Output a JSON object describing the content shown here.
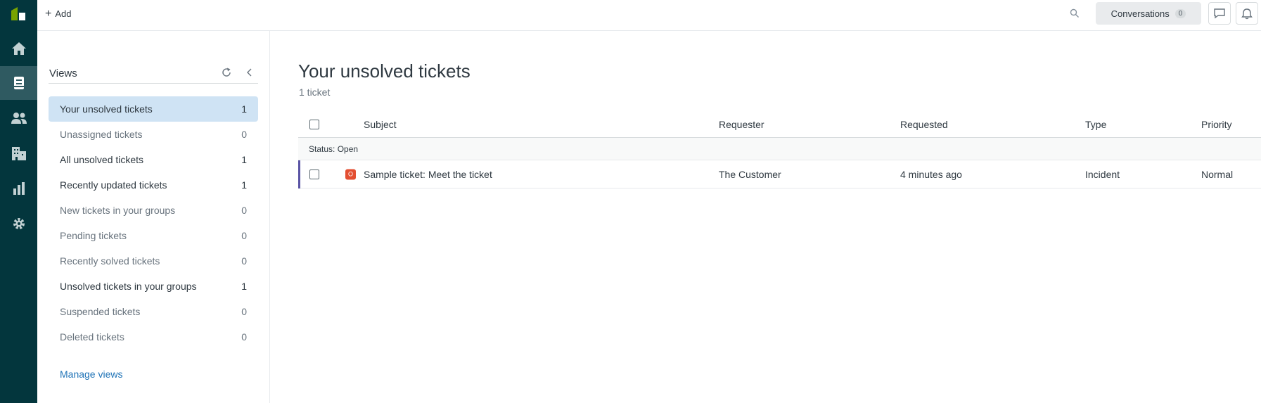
{
  "topbar": {
    "add_label": "Add",
    "conversations_label": "Conversations",
    "conversations_count": "0"
  },
  "rail": {
    "items": [
      "home-icon",
      "views-icon",
      "customers-icon",
      "organizations-icon",
      "reporting-icon",
      "admin-icon"
    ],
    "active": "views-icon"
  },
  "views": {
    "title": "Views",
    "items": [
      {
        "label": "Your unsolved tickets",
        "count": "1"
      },
      {
        "label": "Unassigned tickets",
        "count": "0"
      },
      {
        "label": "All unsolved tickets",
        "count": "1"
      },
      {
        "label": "Recently updated tickets",
        "count": "1"
      },
      {
        "label": "New tickets in your groups",
        "count": "0"
      },
      {
        "label": "Pending tickets",
        "count": "0"
      },
      {
        "label": "Recently solved tickets",
        "count": "0"
      },
      {
        "label": "Unsolved tickets in your groups",
        "count": "1"
      },
      {
        "label": "Suspended tickets",
        "count": "0"
      },
      {
        "label": "Deleted tickets",
        "count": "0"
      }
    ],
    "manage_label": "Manage views"
  },
  "main": {
    "title": "Your unsolved tickets",
    "count_text": "1 ticket",
    "columns": [
      "Subject",
      "Requester",
      "Requested",
      "Type",
      "Priority"
    ],
    "group_label": "Status: Open",
    "rows": [
      {
        "status": "O",
        "subject": "Sample ticket: Meet the ticket",
        "requester": "The Customer",
        "requested": "4 minutes ago",
        "type": "Incident",
        "priority": "Normal"
      }
    ]
  },
  "colors": {
    "rail": "#03363d",
    "active_view": "#cfe3f4",
    "status_open": "#e34f32",
    "row_marker": "#5953a4",
    "link": "#1f73b7"
  }
}
